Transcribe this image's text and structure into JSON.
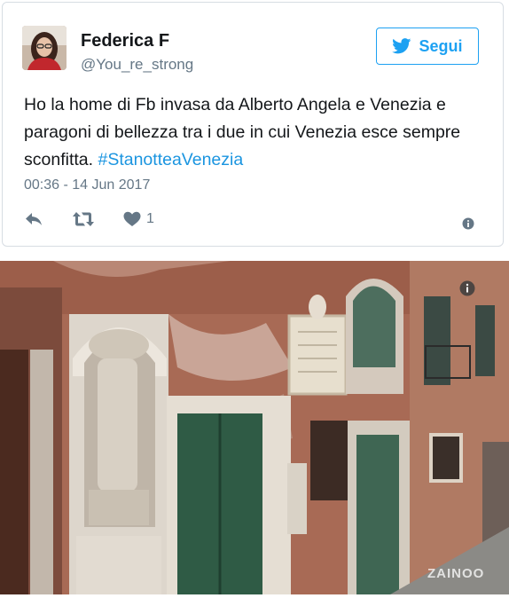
{
  "tweet": {
    "display_name": "Federica F",
    "handle": "@You_re_strong",
    "follow_label": "Segui",
    "text_plain": "Ho la home di Fb invasa da Alberto Angela e Venezia e paragoni di bellezza tra i due in cui Venezia esce sempre sconfitta. ",
    "hashtag": "#StanotteaVenezia",
    "timestamp": "00:36 - 14 Jun 2017",
    "like_count": "1"
  },
  "icons": {
    "follow": "twitter-bird-icon",
    "reply": "reply-icon",
    "retweet": "retweet-icon",
    "like": "heart-icon",
    "info": "info-icon"
  },
  "colors": {
    "accent": "#1da1f2",
    "hashtag": "#1b95e0",
    "secondary_text": "#657786"
  },
  "photo": {
    "watermark": "ZAINOO"
  }
}
